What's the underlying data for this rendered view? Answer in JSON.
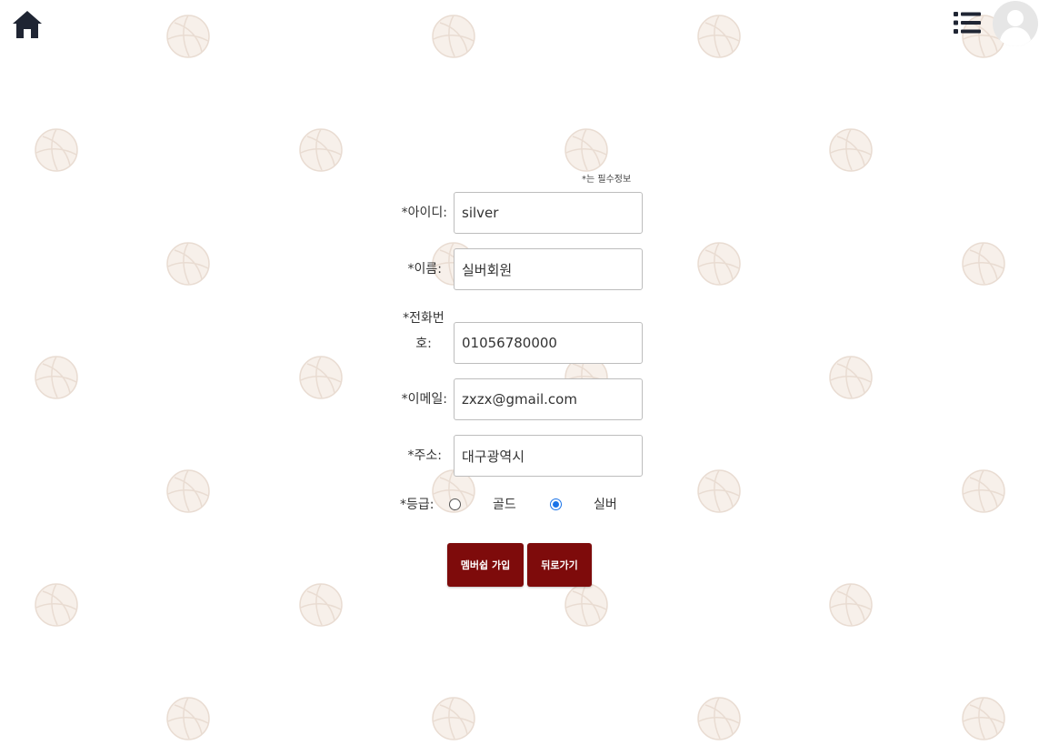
{
  "header": {
    "home_icon": "home-icon",
    "menu_icon": "list-icon",
    "avatar_icon": "user-avatar-icon"
  },
  "background": {
    "pattern_icon": "volleyball-icon",
    "pattern_color": "#e9dcd2"
  },
  "form": {
    "required_note": "*는 필수정보",
    "fields": {
      "id": {
        "label": "*아이디:",
        "value": "silver"
      },
      "name": {
        "label": "*이름:",
        "value": "실버회원"
      },
      "phone": {
        "label": "*전화번호:",
        "value": "01056780000"
      },
      "email": {
        "label": "*이메일:",
        "value": "zxzx@gmail.com"
      },
      "address": {
        "label": "*주소:",
        "value": "대구광역시"
      }
    },
    "grade": {
      "label": "*등급:",
      "options": [
        "골드",
        "실버"
      ],
      "selected": "실버"
    },
    "buttons": {
      "join": "멤버쉽 가입",
      "back": "뒤로가기"
    }
  },
  "colors": {
    "button": "#7e0b0b",
    "radio_accent": "#1a73e8",
    "icon": "#1f2533"
  }
}
